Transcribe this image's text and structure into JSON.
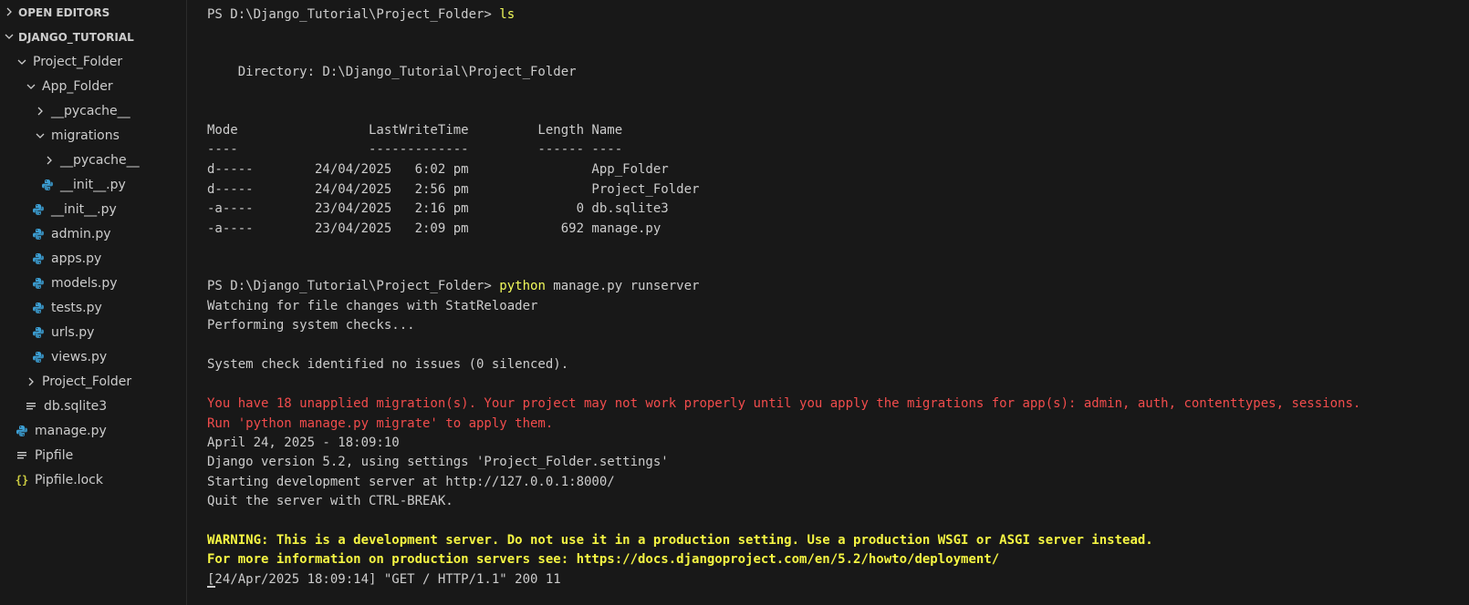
{
  "explorer": {
    "open_editors_label": "OPEN EDITORS",
    "workspace_label": "DJANGO_TUTORIAL",
    "items": [
      {
        "label": "Project_Folder",
        "kind": "folder-open"
      },
      {
        "label": "App_Folder",
        "kind": "folder-open"
      },
      {
        "label": "__pycache__",
        "kind": "folder-closed"
      },
      {
        "label": "migrations",
        "kind": "folder-open"
      },
      {
        "label": "__pycache__",
        "kind": "folder-closed"
      },
      {
        "label": "__init__.py",
        "kind": "python"
      },
      {
        "label": "__init__.py",
        "kind": "python"
      },
      {
        "label": "admin.py",
        "kind": "python"
      },
      {
        "label": "apps.py",
        "kind": "python"
      },
      {
        "label": "models.py",
        "kind": "python"
      },
      {
        "label": "tests.py",
        "kind": "python"
      },
      {
        "label": "urls.py",
        "kind": "python"
      },
      {
        "label": "views.py",
        "kind": "python"
      },
      {
        "label": "Project_Folder",
        "kind": "folder-closed"
      },
      {
        "label": "db.sqlite3",
        "kind": "text"
      },
      {
        "label": "manage.py",
        "kind": "python"
      },
      {
        "label": "Pipfile",
        "kind": "text"
      },
      {
        "label": "Pipfile.lock",
        "kind": "json"
      }
    ]
  },
  "colors": {
    "python_icon": "#3c9fd4",
    "json_icon": "#cbcb41",
    "error_text": "#f14c4c",
    "command_text": "#f1fa5b",
    "warning_text": "#f5f543"
  },
  "terminal": {
    "prompt1": "PS D:\\Django_Tutorial\\Project_Folder> ",
    "cmd1": "ls",
    "directory_line": "    Directory: D:\\Django_Tutorial\\Project_Folder",
    "header_line": "Mode                 LastWriteTime         Length Name",
    "separator_line": "----                 -------------         ------ ----",
    "rows": [
      "d-----        24/04/2025   6:02 pm                App_Folder",
      "d-----        24/04/2025   2:56 pm                Project_Folder",
      "-a----        23/04/2025   2:16 pm              0 db.sqlite3",
      "-a----        23/04/2025   2:09 pm            692 manage.py"
    ],
    "prompt2": "PS D:\\Django_Tutorial\\Project_Folder> ",
    "cmd2_exe": "python",
    "cmd2_args": " manage.py runserver",
    "watching": "Watching for file changes with StatReloader",
    "performing": "Performing system checks...",
    "check_result": "System check identified no issues (0 silenced).",
    "migration_warning_1": "You have 18 unapplied migration(s). Your project may not work properly until you apply the migrations for app(s): admin, auth, contenttypes, sessions.",
    "migration_warning_2": "Run 'python manage.py migrate' to apply them.",
    "date_line": "April 24, 2025 - 18:09:10",
    "django_version": "Django version 5.2, using settings 'Project_Folder.settings'",
    "starting_server": "Starting development server at http://127.0.0.1:8000/",
    "quit_hint": "Quit the server with CTRL-BREAK.",
    "dev_warning_1": "WARNING: This is a development server. Do not use it in a production setting. Use a production WSGI or ASGI server instead.",
    "dev_warning_2": "For more information on production servers see: https://docs.djangoproject.com/en/5.2/howto/deployment/",
    "request_log": "[24/Apr/2025 18:09:14] \"GET / HTTP/1.1\" 200 11"
  }
}
